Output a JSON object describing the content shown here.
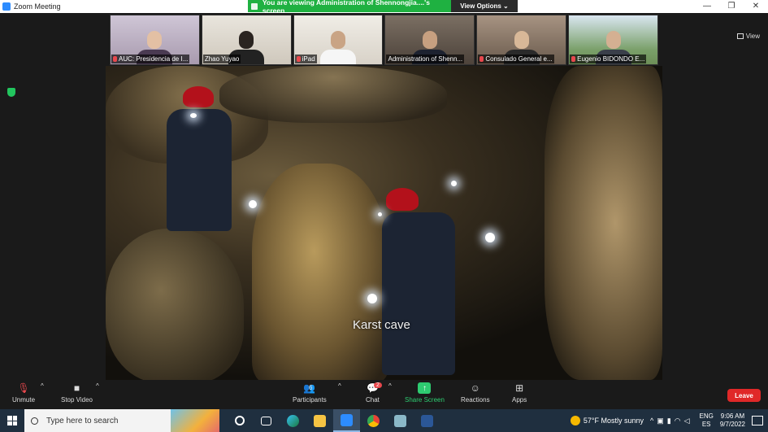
{
  "window": {
    "title": "Zoom Meeting",
    "controls": [
      "—",
      "❐",
      "✕"
    ]
  },
  "share_banner": {
    "text": "You are viewing Administration of Shennongjia....'s screen",
    "options_label": "View Options ⌄"
  },
  "view_button": {
    "label": "View"
  },
  "participants": [
    {
      "name": "AUC: Presidencia de I...",
      "muted": true
    },
    {
      "name": "Zhao Yuyao",
      "muted": false
    },
    {
      "name": "iPad",
      "muted": true
    },
    {
      "name": "Administration of Shenn...",
      "muted": false
    },
    {
      "name": "Consulado General e...",
      "muted": true
    },
    {
      "name": "Eugenio BIDONDO E...",
      "muted": true
    }
  ],
  "shared_content": {
    "caption": "Karst cave"
  },
  "toolbar": {
    "unmute": "Unmute",
    "stop_video": "Stop Video",
    "participants": "Participants",
    "participants_count": "6",
    "chat": "Chat",
    "chat_badge": "2",
    "share_screen": "Share Screen",
    "reactions": "Reactions",
    "apps": "Apps",
    "leave": "Leave"
  },
  "taskbar": {
    "search_placeholder": "Type here to search",
    "weather": "57°F  Mostly sunny",
    "lang_top": "ENG",
    "lang_bottom": "ES",
    "time": "9:06 AM",
    "date": "9/7/2022",
    "apps": [
      "task-view",
      "edge",
      "file-explorer",
      "zoom",
      "chrome",
      "store",
      "word"
    ]
  }
}
